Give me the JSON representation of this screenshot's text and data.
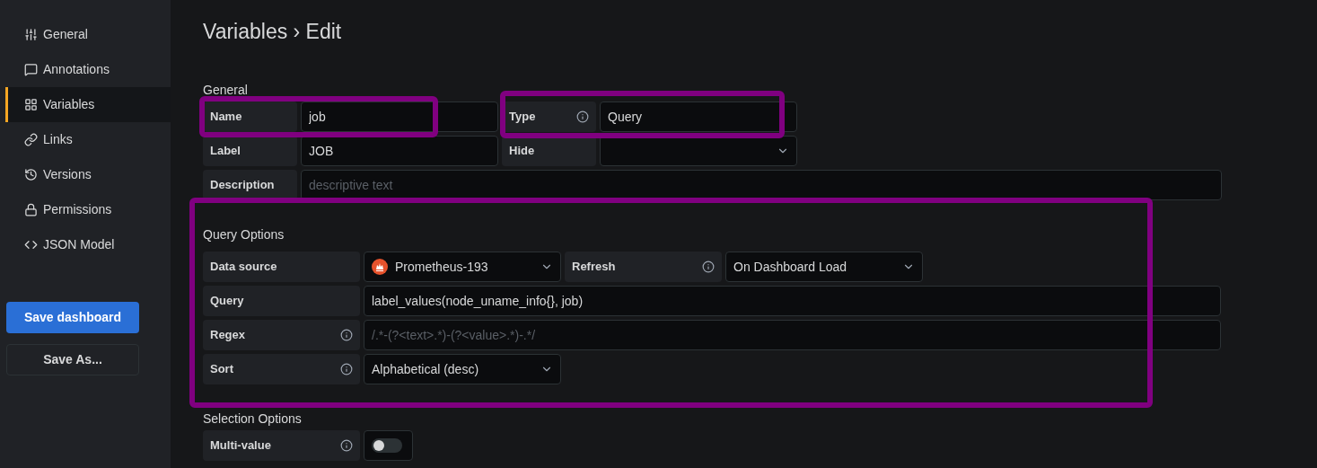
{
  "sidebar": {
    "items": [
      {
        "label": "General",
        "selected": false
      },
      {
        "label": "Annotations",
        "selected": false
      },
      {
        "label": "Variables",
        "selected": true
      },
      {
        "label": "Links",
        "selected": false
      },
      {
        "label": "Versions",
        "selected": false
      },
      {
        "label": "Permissions",
        "selected": false
      },
      {
        "label": "JSON Model",
        "selected": false
      }
    ],
    "buttons": [
      {
        "label": "Save dashboard",
        "kind": "primary"
      },
      {
        "label": "Save As...",
        "kind": "secondary"
      }
    ]
  },
  "title": "Variables › Edit",
  "general": {
    "heading": "General",
    "name": {
      "label": "Name",
      "value": "job"
    },
    "type": {
      "label": "Type",
      "value": "Query"
    },
    "label": {
      "label": "Label",
      "value": "JOB"
    },
    "hide": {
      "label": "Hide"
    },
    "description": {
      "label": "Description",
      "placeholder": "descriptive text"
    }
  },
  "query_options": {
    "heading": "Query Options",
    "data_source": {
      "label": "Data source",
      "value": "Prometheus-193"
    },
    "refresh": {
      "label": "Refresh",
      "value": "On Dashboard Load"
    },
    "query": {
      "label": "Query",
      "value": "label_values(node_uname_info{}, job)"
    },
    "regex": {
      "label": "Regex",
      "placeholder": "/.*-(?<text>.*)-(?<value>.*)-.*/"
    },
    "sort": {
      "label": "Sort",
      "value": "Alphabetical (desc)"
    }
  },
  "selection_options": {
    "heading": "Selection Options",
    "multi_value": {
      "label": "Multi-value",
      "on": false
    }
  }
}
